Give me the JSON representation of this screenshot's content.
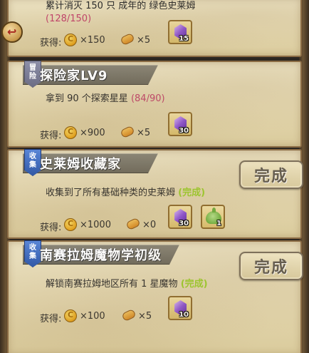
{
  "quests": [
    {
      "title": "",
      "badge": [
        "",
        ""
      ],
      "description": "累计消灭 150 只 成年的 绿色史莱姆",
      "progress": "(128/150)",
      "status": "",
      "reward_label": "获得:",
      "coins": "×150",
      "bread": "×5",
      "items": [
        {
          "icon": "purple-gem-icon",
          "count": "15"
        }
      ],
      "button": ""
    },
    {
      "title": "探险家LV9",
      "badge": [
        "冒",
        "险"
      ],
      "description": "拿到 90 个探索星星",
      "progress": "(84/90)",
      "status": "",
      "reward_label": "获得:",
      "coins": "×900",
      "bread": "×5",
      "items": [
        {
          "icon": "purple-gem-icon",
          "count": "30"
        }
      ],
      "button": ""
    },
    {
      "title": "史莱姆收藏家",
      "badge": [
        "收",
        "集"
      ],
      "description": "收集到了所有基础种类的史莱姆",
      "progress": "",
      "status": "(完成)",
      "reward_label": "获得:",
      "coins": "×1000",
      "bread": "×0",
      "items": [
        {
          "icon": "purple-gem-icon",
          "count": "30"
        },
        {
          "icon": "green-slime-icon",
          "count": "1"
        }
      ],
      "button": "完成"
    },
    {
      "title": "南赛拉姆魔物学初级",
      "badge": [
        "收",
        "集"
      ],
      "description": "解锁南赛拉姆地区所有 1 星魔物",
      "progress": "",
      "status": "(完成)",
      "reward_label": "获得:",
      "coins": "×100",
      "bread": "×5",
      "items": [
        {
          "icon": "purple-gem-icon",
          "count": "10"
        }
      ],
      "button": "完成"
    }
  ],
  "colors": {
    "progress": "#c2406b",
    "complete": "#9ccf2a",
    "badge_blue": "#2f58a8"
  },
  "icons": {
    "back": "back-arrow-icon",
    "coin": "gold-coin-icon",
    "bread": "bread-icon"
  }
}
